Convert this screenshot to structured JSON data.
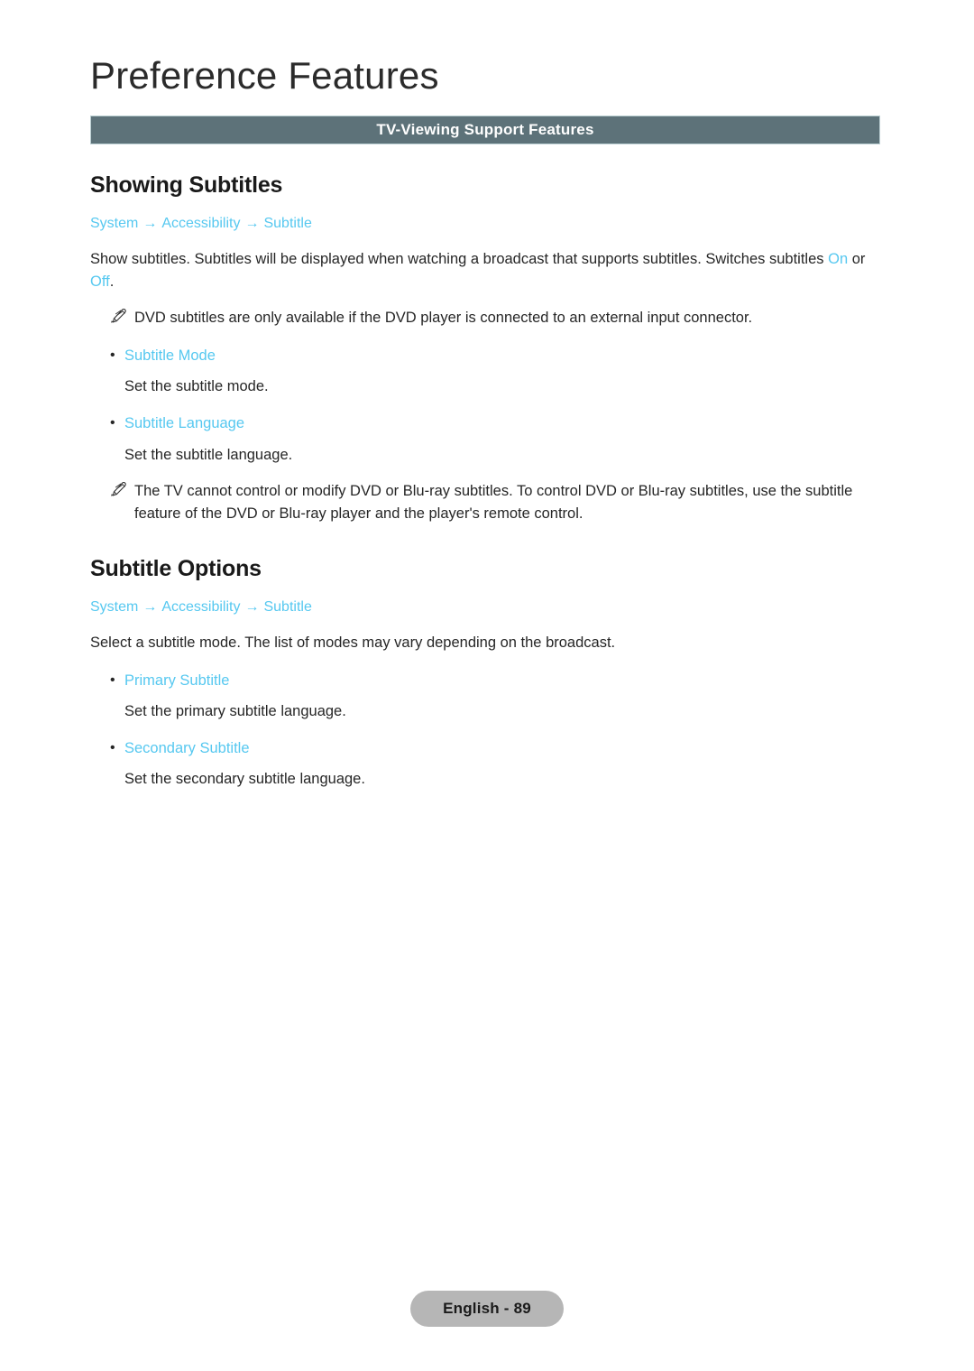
{
  "document": {
    "chapter_title": "Preference Features",
    "section_banner": {
      "label": "TV-Viewing Support Features",
      "background_color": "#5d7279",
      "text_color": "#ffffff"
    },
    "accent_color": "#56c8f0",
    "sections": [
      {
        "heading": "Showing Subtitles",
        "breadcrumb": {
          "items": [
            "System",
            "Accessibility",
            "Subtitle"
          ],
          "separator": "→"
        },
        "intro": {
          "part1": "Show subtitles. Subtitles will be displayed when watching a broadcast that supports subtitles. Switches subtitles ",
          "highlight1": "On",
          "part2": " or ",
          "highlight2": "Off",
          "part3": "."
        },
        "note_top": {
          "icon": "pencil-note-icon",
          "text": "DVD subtitles are only available if the DVD player is connected to an external input connector."
        },
        "options": [
          {
            "label": "Subtitle Mode",
            "description": "Set the subtitle mode."
          },
          {
            "label": "Subtitle Language",
            "description": "Set the subtitle language."
          }
        ],
        "note_bottom": {
          "icon": "pencil-note-icon",
          "text": "The TV cannot control or modify DVD or Blu-ray subtitles. To control DVD or Blu-ray subtitles, use the subtitle feature of the DVD or Blu-ray player and the player's remote control."
        }
      },
      {
        "heading": "Subtitle Options",
        "breadcrumb": {
          "items": [
            "System",
            "Accessibility",
            "Subtitle"
          ],
          "separator": "→"
        },
        "intro_plain": "Select a subtitle mode. The list of modes may vary depending on the broadcast.",
        "options": [
          {
            "label": "Primary Subtitle",
            "description": "Set the primary subtitle language."
          },
          {
            "label": "Secondary Subtitle",
            "description": "Set the secondary subtitle language."
          }
        ]
      }
    ],
    "footer": {
      "page_label": "English - 89"
    }
  }
}
